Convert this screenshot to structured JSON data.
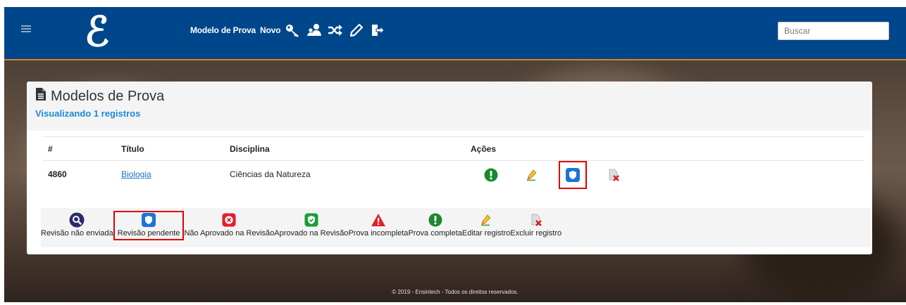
{
  "navbar": {
    "logo": "ℰ",
    "links": [
      "Modelo de Prova",
      "Novo"
    ],
    "icons": [
      "key-icon",
      "users-icon",
      "shuffle-icon",
      "pencil-icon",
      "sign-out-icon"
    ],
    "search_placeholder": "Buscar"
  },
  "panel": {
    "title": "Modelos de Prova",
    "subtitle": "Visualizando 1 registros"
  },
  "table": {
    "headers": [
      "#",
      "Título",
      "Disciplina",
      "Ações"
    ],
    "rows": [
      {
        "id": "4860",
        "titulo": "Biologia",
        "disciplina": "Ciências da Natureza"
      }
    ],
    "row_actions": [
      "exclamation-circle-icon",
      "edit-pencil-icon",
      "shield-pending-icon",
      "delete-file-icon"
    ]
  },
  "legend": [
    {
      "label": "Revisão não enviada",
      "icon": "search-icon"
    },
    {
      "label": "Revisão pendente",
      "icon": "shield-icon"
    },
    {
      "label": "Não Aprovado na Revisão",
      "icon": "x-square-icon"
    },
    {
      "label": "Aprovado na Revisão",
      "icon": "check-square-icon"
    },
    {
      "label": "Prova incompleta",
      "icon": "warning-icon"
    },
    {
      "label": "Prova completa",
      "icon": "exclamation-circle-icon"
    },
    {
      "label": "Editar registro",
      "icon": "edit-pencil-icon"
    },
    {
      "label": "Excluir registro",
      "icon": "delete-file-icon"
    }
  ],
  "footer": "© 2019 - Ensintech - Todos os direitos reservados.",
  "colors": {
    "navbar": "#00468b",
    "accent_line": "#d9822b",
    "link": "#1a8ad8",
    "pending_blue": "#1e73d8",
    "approved_green": "#1a9e3a",
    "rejected_red": "#e0202a",
    "highlight_red": "#e00000"
  }
}
